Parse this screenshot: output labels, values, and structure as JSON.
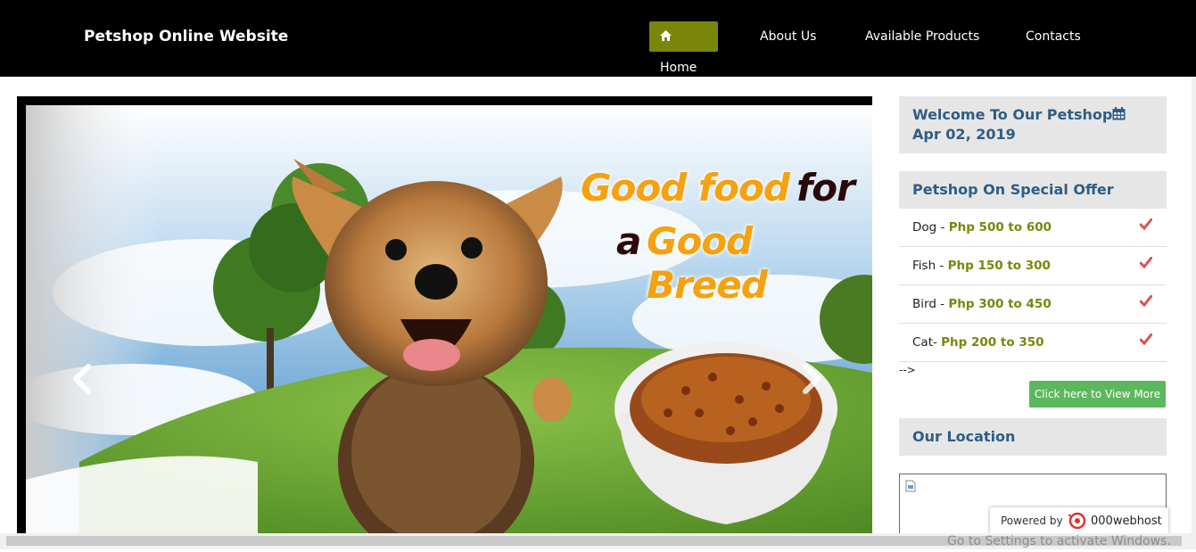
{
  "header": {
    "brand": "Petshop Online Website",
    "nav": [
      {
        "label": "Home",
        "icon": "home-icon",
        "active": true
      },
      {
        "label": "About Us"
      },
      {
        "label": "Available Products"
      },
      {
        "label": "Contacts"
      }
    ],
    "accent_color": "#7a860a"
  },
  "carousel": {
    "headline_line1_a": "Good food",
    "headline_line1_b": "for",
    "headline_line2_a": "a",
    "headline_line2_b": "Good Breed",
    "prev_icon": "chevron-left-icon",
    "next_icon": "chevron-right-icon"
  },
  "sidebar": {
    "welcome": {
      "text": "Welcome To Our Petshop",
      "calendar_icon": "calendar-icon",
      "date": "Apr 02, 2019"
    },
    "offer": {
      "title": "Petshop On Special Offer",
      "items": [
        {
          "label": "Dog - ",
          "price": "Php 500 to 600"
        },
        {
          "label": "Fish - ",
          "price": "Php 150 to 300"
        },
        {
          "label": "Bird - ",
          "price": "Php 300 to 450"
        },
        {
          "label": "Cat- ",
          "price": "Php 200 to 350"
        }
      ],
      "check_icon": "check-icon"
    },
    "stray_text": "-->",
    "view_more": "Click here to View More",
    "location_title": "Our Location"
  },
  "footer_badge": {
    "powered_by": "Powered by",
    "host": "000webhost"
  },
  "os_overlay": {
    "activate_hint": "Go to Settings to activate Windows."
  }
}
